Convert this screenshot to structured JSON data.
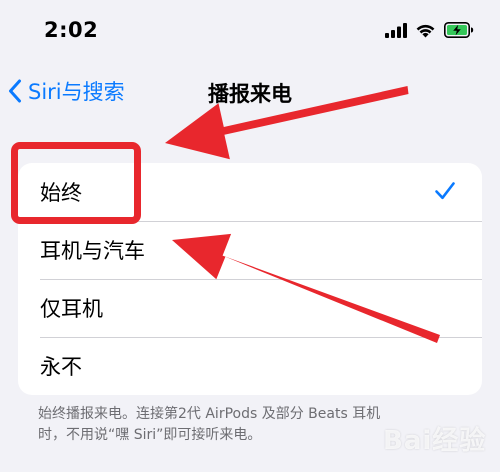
{
  "status_bar": {
    "time": "2:02"
  },
  "nav": {
    "back_label": "Siri与搜索",
    "title": "播报来电"
  },
  "options": [
    {
      "label": "始终",
      "selected": true
    },
    {
      "label": "耳机与汽车",
      "selected": false
    },
    {
      "label": "仅耳机",
      "selected": false
    },
    {
      "label": "永不",
      "selected": false
    }
  ],
  "footer": {
    "note_line1": "始终播报来电。连接第2代 AirPods 及部分 Beats 耳机",
    "note_line2": "时，不用说“嘿 Siri”即可接听来电。"
  },
  "watermark": "Bai经验",
  "colors": {
    "accent": "#0a7aff",
    "annotation": "#e8272d",
    "battery": "#34c759"
  },
  "icons": [
    "signal-icon",
    "wifi-icon",
    "battery-charging-icon",
    "chevron-left-icon",
    "checkmark-icon"
  ]
}
